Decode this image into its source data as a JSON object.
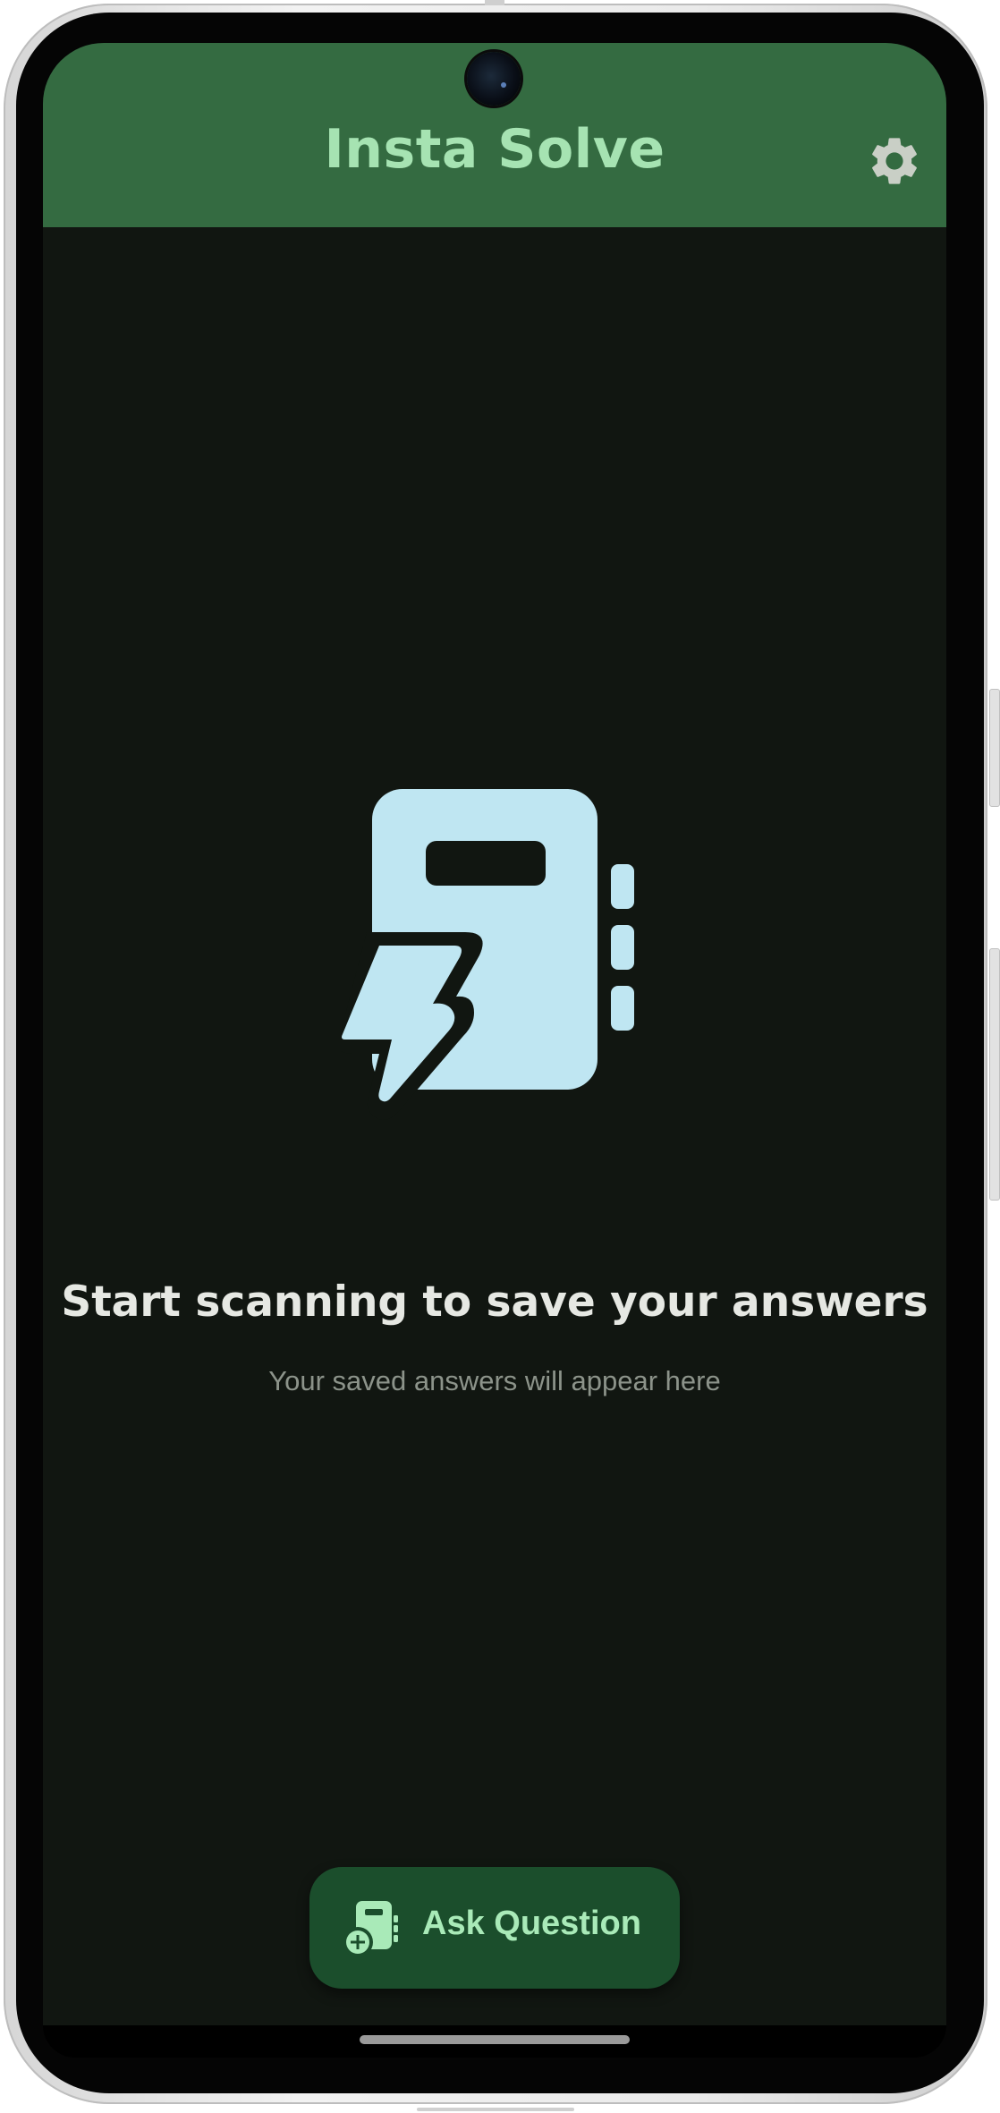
{
  "app_bar": {
    "title": "Insta Solve",
    "background_color": "#346b41",
    "title_color": "#a6e3b2",
    "settings_icon": "gear-icon"
  },
  "empty_state": {
    "icon": "notebook-bolt-icon",
    "icon_color": "#bfe6f2",
    "title": "Start scanning to save your answers",
    "subtitle": "Your saved answers will appear here"
  },
  "fab": {
    "icon": "notebook-add-icon",
    "label": "Ask Question",
    "background_color": "#1b4e2c",
    "label_color": "#a9eab8"
  },
  "colors": {
    "screen_background": "#111611"
  }
}
